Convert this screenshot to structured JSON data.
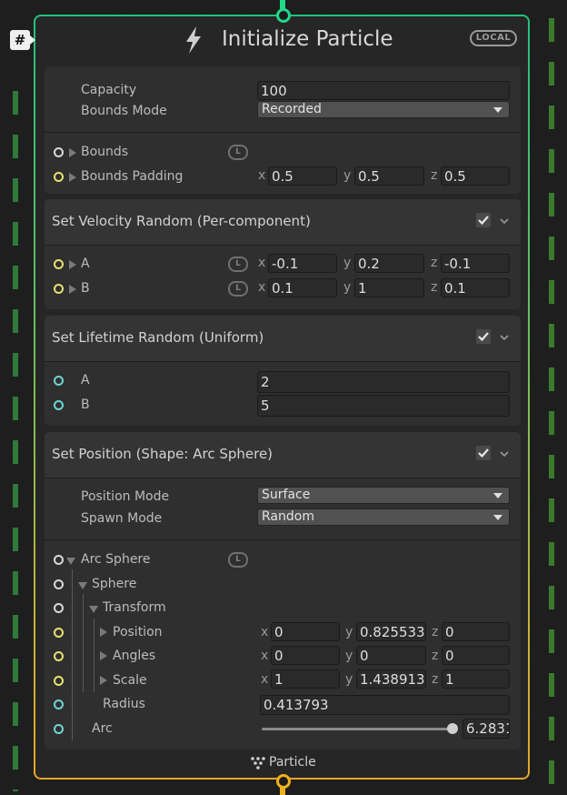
{
  "node": {
    "title": "Initialize Particle",
    "space_badge": "LOCAL",
    "hash": "#",
    "output_label": "Particle",
    "accent_top": "#22d88a",
    "accent_bottom": "#f0b020"
  },
  "init": {
    "capacity_label": "Capacity",
    "capacity_value": "100",
    "bounds_mode_label": "Bounds Mode",
    "bounds_mode_value": "Recorded",
    "bounds_label": "Bounds",
    "bounds_padding_label": "Bounds Padding",
    "bounds_padding": {
      "x": "0.5",
      "y": "0.5",
      "z": "0.5"
    }
  },
  "velocity": {
    "title": "Set Velocity Random (Per-component)",
    "a_label": "A",
    "a": {
      "x": "-0.1",
      "y": "0.2",
      "z": "-0.1"
    },
    "b_label": "B",
    "b": {
      "x": "0.1",
      "y": "1",
      "z": "0.1"
    }
  },
  "lifetime": {
    "title": "Set Lifetime Random (Uniform)",
    "a_label": "A",
    "a_value": "2",
    "b_label": "B",
    "b_value": "5"
  },
  "position": {
    "title": "Set Position (Shape: Arc Sphere)",
    "position_mode_label": "Position Mode",
    "position_mode_value": "Surface",
    "spawn_mode_label": "Spawn Mode",
    "spawn_mode_value": "Random",
    "arc_sphere_label": "Arc Sphere",
    "sphere_label": "Sphere",
    "transform_label": "Transform",
    "position_label": "Position",
    "position": {
      "x": "0",
      "y": "0.825533",
      "z": "0"
    },
    "angles_label": "Angles",
    "angles": {
      "x": "0",
      "y": "0",
      "z": "0"
    },
    "scale_label": "Scale",
    "scale": {
      "x": "1",
      "y": "1.438913",
      "z": "1"
    },
    "radius_label": "Radius",
    "radius_value": "0.413793",
    "arc_label": "Arc",
    "arc_value": "6.2831",
    "arc_fraction": 1.0
  },
  "axes": {
    "x": "x",
    "y": "y",
    "z": "z"
  },
  "link_badge": "L"
}
